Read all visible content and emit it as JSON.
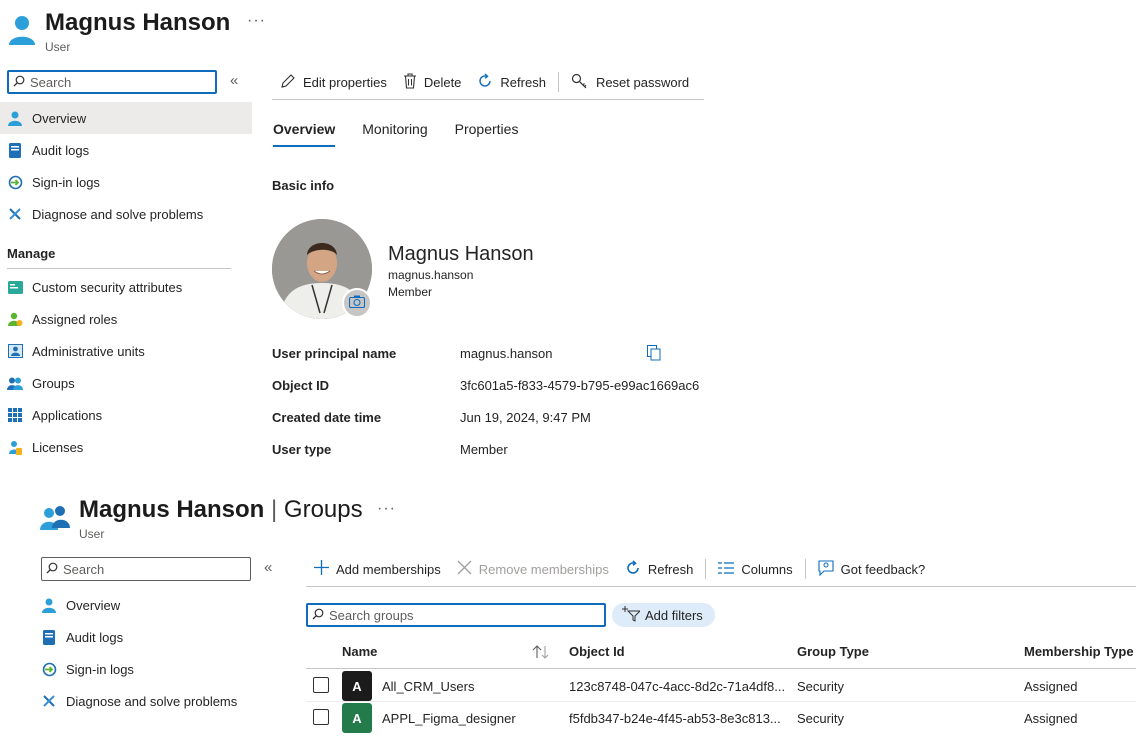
{
  "top_blade": {
    "title": "Magnus Hanson",
    "subtitle": "User",
    "more": "···",
    "search_placeholder": "Search",
    "collapse": "«",
    "nav": [
      {
        "label": "Overview",
        "icon": "user-icon"
      },
      {
        "label": "Audit logs",
        "icon": "audit-log-icon"
      },
      {
        "label": "Sign-in logs",
        "icon": "sign-in-icon"
      },
      {
        "label": "Diagnose and solve problems",
        "icon": "wrench-icon"
      }
    ],
    "manage_header": "Manage",
    "manage": [
      {
        "label": "Custom security attributes",
        "icon": "security-attributes-icon"
      },
      {
        "label": "Assigned roles",
        "icon": "roles-icon"
      },
      {
        "label": "Administrative units",
        "icon": "admin-units-icon"
      },
      {
        "label": "Groups",
        "icon": "groups-icon"
      },
      {
        "label": "Applications",
        "icon": "applications-icon"
      },
      {
        "label": "Licenses",
        "icon": "licenses-icon"
      }
    ],
    "toolbar": {
      "edit": "Edit properties",
      "delete": "Delete",
      "refresh": "Refresh",
      "reset": "Reset password"
    },
    "tabs": [
      "Overview",
      "Monitoring",
      "Properties"
    ],
    "basic_info": "Basic info",
    "profile": {
      "name": "Magnus Hanson",
      "upn_short": "magnus.hanson",
      "type": "Member"
    },
    "properties": [
      {
        "label": "User principal name",
        "value": "magnus.hanson"
      },
      {
        "label": "Object ID",
        "value": "3fc601a5-f833-4579-b795-e99ac1669ac6"
      },
      {
        "label": "Created date time",
        "value": "Jun 19, 2024, 9:47 PM"
      },
      {
        "label": "User type",
        "value": "Member"
      }
    ]
  },
  "bottom_blade": {
    "title": "Magnus Hanson",
    "title_sep": "|",
    "title_section": "Groups",
    "subtitle": "User",
    "more": "···",
    "search_placeholder": "Search",
    "collapse": "«",
    "nav": [
      {
        "label": "Overview"
      },
      {
        "label": "Audit logs"
      },
      {
        "label": "Sign-in logs"
      },
      {
        "label": "Diagnose and solve problems"
      }
    ],
    "toolbar": {
      "add": "Add memberships",
      "remove": "Remove memberships",
      "refresh": "Refresh",
      "columns": "Columns",
      "feedback": "Got feedback?"
    },
    "search_groups_placeholder": "Search groups",
    "add_filters": "Add filters",
    "table": {
      "columns": [
        "Name",
        "Object Id",
        "Group Type",
        "Membership Type"
      ],
      "rows": [
        {
          "initial": "A",
          "color": "#1b1b1b",
          "name": "All_CRM_Users",
          "object_id": "123c8748-047c-4acc-8d2c-71a4df8...",
          "group_type": "Security",
          "membership": "Assigned"
        },
        {
          "initial": "A",
          "color": "#237b4b",
          "name": "APPL_Figma_designer",
          "object_id": "f5fdb347-b24e-4f45-ab53-8e3c813...",
          "group_type": "Security",
          "membership": "Assigned"
        }
      ]
    }
  },
  "colors": {
    "accent": "#0f6cbd",
    "selected_bg": "#edebe9",
    "pill_bg": "#deecf9"
  }
}
